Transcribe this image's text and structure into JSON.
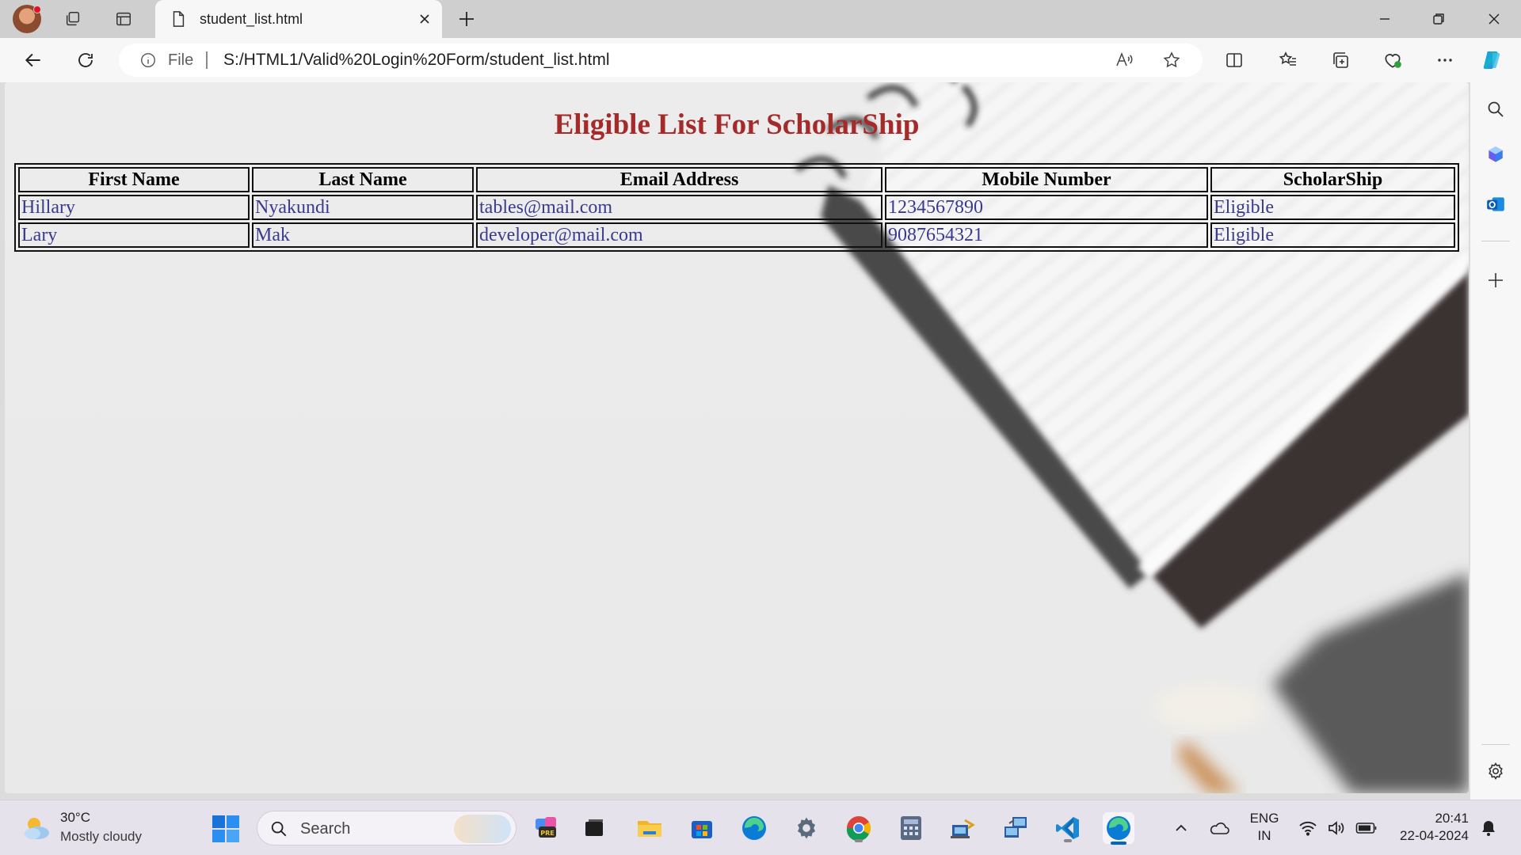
{
  "browser": {
    "tab": {
      "title": "student_list.html"
    },
    "address": {
      "scheme_label": "File",
      "url": "S:/HTML1/Valid%20Login%20Form/student_list.html"
    }
  },
  "page": {
    "heading": "Eligible List For ScholarShip",
    "table": {
      "headers": [
        "First Name",
        "Last Name",
        "Email Address",
        "Mobile Number",
        "ScholarShip"
      ],
      "rows": [
        [
          "Hillary",
          "Nyakundi",
          "tables@mail.com",
          "1234567890",
          "Eligible"
        ],
        [
          "Lary",
          "Mak",
          "developer@mail.com",
          "9087654321",
          "Eligible"
        ]
      ]
    }
  },
  "taskbar": {
    "weather": {
      "temp": "30°C",
      "condition": "Mostly cloudy"
    },
    "search_placeholder": "Search",
    "lang": {
      "line1": "ENG",
      "line2": "IN"
    },
    "clock": {
      "time": "20:41",
      "date": "22-04-2024"
    }
  },
  "colors": {
    "heading": "#a52a2a",
    "cell_text": "#3a3a8c",
    "accent": "#0067c0"
  }
}
